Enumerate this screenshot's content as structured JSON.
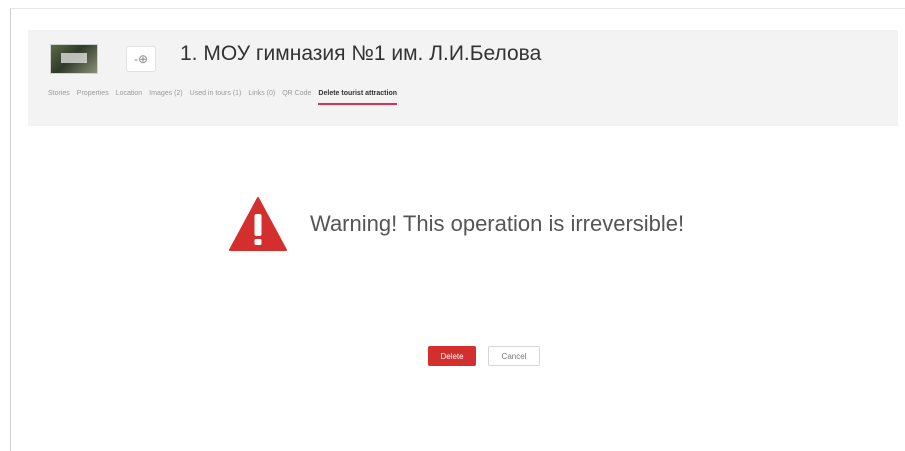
{
  "header": {
    "title": "1. МОУ гимназия №1 им. Л.И.Белова",
    "pin_symbol": "-⊕"
  },
  "tabs": [
    {
      "label": "Stories"
    },
    {
      "label": "Properties"
    },
    {
      "label": "Location"
    },
    {
      "label": "Images (2)"
    },
    {
      "label": "Used in tours (1)"
    },
    {
      "label": "Links (0)"
    },
    {
      "label": "QR Code"
    },
    {
      "label": "Delete tourist attraction",
      "active": true
    }
  ],
  "warning": {
    "text": "Warning! This operation is irreversible!",
    "icon": "warning-triangle-icon",
    "color": "#d32f2f"
  },
  "actions": {
    "delete_label": "Delete",
    "cancel_label": "Cancel"
  },
  "colors": {
    "accent_tab_underline": "#d9305a",
    "danger": "#d32f2f"
  }
}
